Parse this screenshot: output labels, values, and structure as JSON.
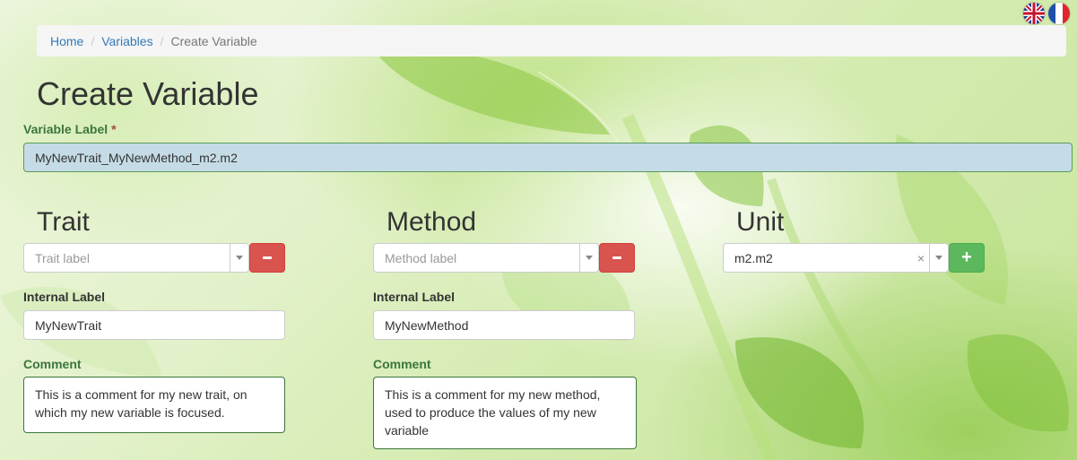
{
  "breadcrumb": {
    "home": "Home",
    "variables": "Variables",
    "current": "Create Variable"
  },
  "page_title": "Create Variable",
  "variable_label": {
    "label": "Variable Label",
    "required_mark": "*",
    "value": "MyNewTrait_MyNewMethod_m2.m2"
  },
  "trait": {
    "heading": "Trait",
    "select_placeholder": "Trait label",
    "remove_icon": "minus-icon",
    "internal_label_caption": "Internal Label",
    "internal_label_value": "MyNewTrait",
    "comment_caption": "Comment",
    "comment_value": "This is a comment for my new trait, on which my new variable is focused."
  },
  "method": {
    "heading": "Method",
    "select_placeholder": "Method label",
    "remove_icon": "minus-icon",
    "internal_label_caption": "Internal Label",
    "internal_label_value": "MyNewMethod",
    "comment_caption": "Comment",
    "comment_value": "This is a comment for my new method, used to produce the values of my new variable"
  },
  "unit": {
    "heading": "Unit",
    "select_value": "m2.m2",
    "clear_glyph": "×",
    "add_glyph": "+"
  },
  "languages": [
    "english-flag-icon",
    "french-flag-icon"
  ],
  "colors": {
    "link": "#337ab7",
    "success_label": "#3c763d",
    "danger": "#d9534f",
    "success": "#5cb85c",
    "variable_input_bg": "#c5dce6"
  }
}
